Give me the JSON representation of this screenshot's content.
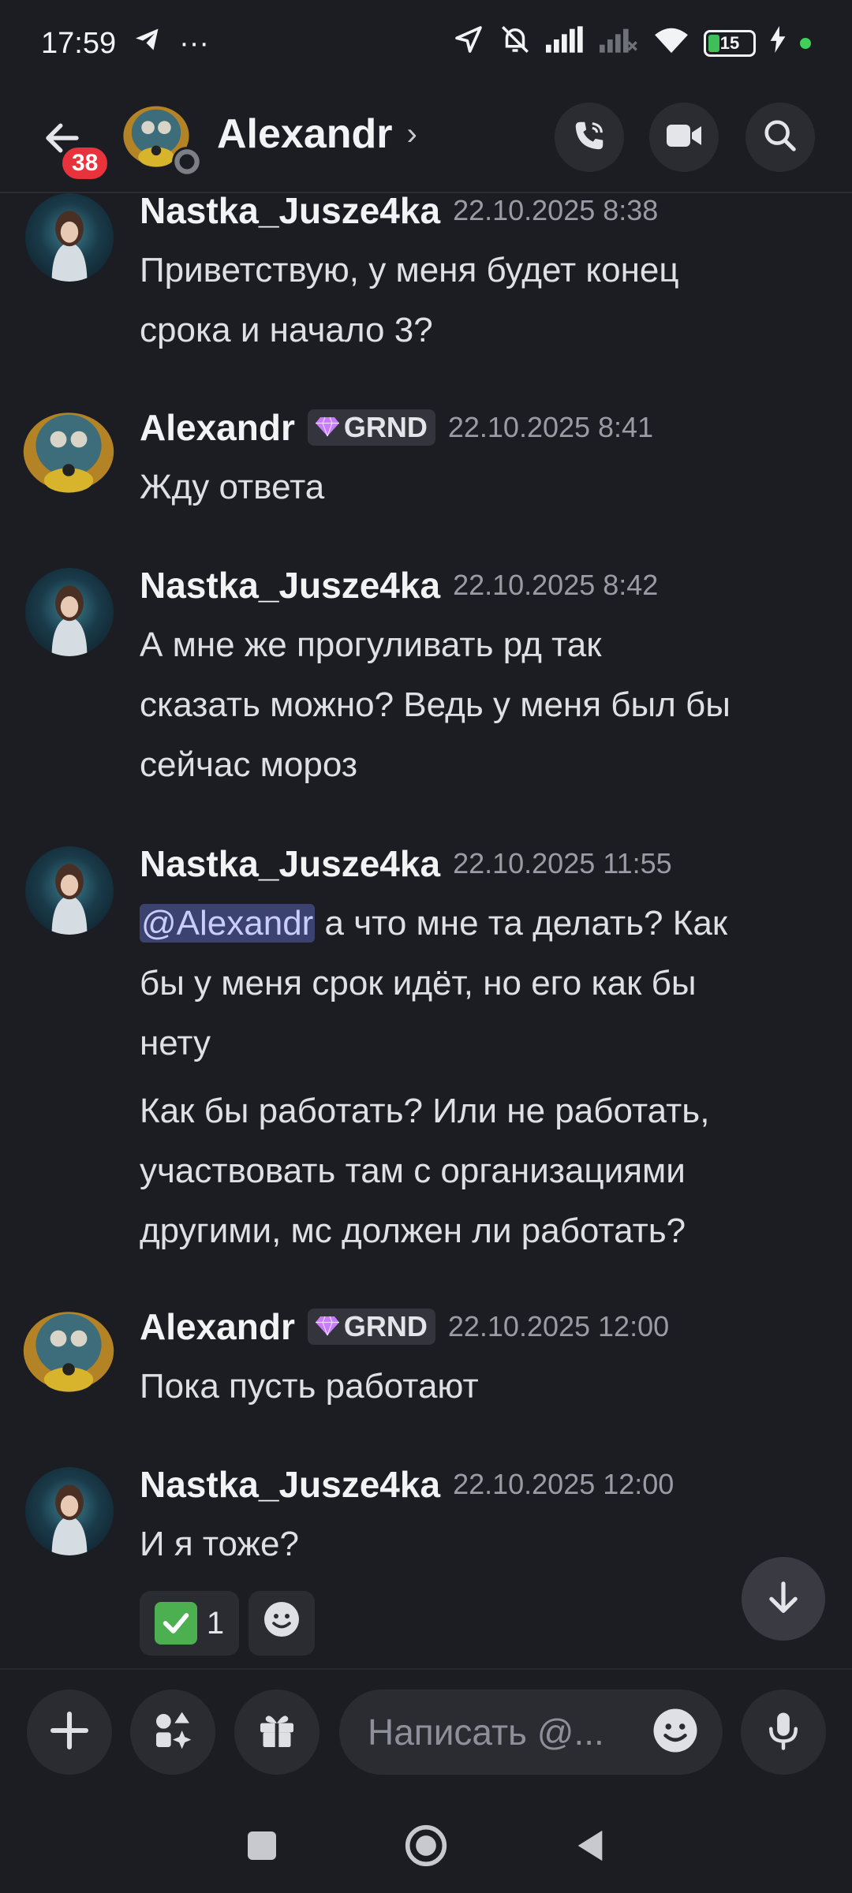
{
  "status_bar": {
    "time": "17:59",
    "dots": "···",
    "battery": "15",
    "icons": [
      "telegram-icon",
      "location-icon",
      "mute-icon",
      "signal-icon",
      "signal-2-icon",
      "wifi-icon",
      "battery-icon",
      "charging-icon"
    ]
  },
  "header": {
    "back_badge": "38",
    "title": "Alexandr",
    "chevron": "›",
    "actions": [
      "call-icon",
      "video-icon",
      "search-icon"
    ]
  },
  "messages": [
    {
      "author": "Nastka_Jusze4ka",
      "timestamp": "22.10.2025 8:38",
      "lines": [
        "Приветствую, у меня будет конец",
        "срока и начало 3?"
      ]
    },
    {
      "author": "Alexandr",
      "tag": "GRND",
      "timestamp": "22.10.2025 8:41",
      "lines": [
        "Жду ответа"
      ]
    },
    {
      "author": "Nastka_Jusze4ka",
      "timestamp": "22.10.2025 8:42",
      "lines": [
        "А мне же прогуливать рд так",
        "сказать можно? Ведь у меня был бы",
        "сейчас мороз"
      ]
    },
    {
      "author": "Nastka_Jusze4ka",
      "timestamp": "22.10.2025 11:55",
      "mention": "@Alexandr",
      "first_line_rest": " а что мне та делать? Как",
      "lines": [
        "бы у меня срок идёт, но его как бы",
        "нету"
      ],
      "followup_lines": [
        "Как бы работать? Или не работать,",
        "участвовать там с организациями",
        "другими, мс должен ли работать?"
      ]
    },
    {
      "author": "Alexandr",
      "tag": "GRND",
      "timestamp": "22.10.2025 12:00",
      "lines": [
        "Пока пусть работают"
      ]
    },
    {
      "author": "Nastka_Jusze4ka",
      "timestamp": "22.10.2025 12:00",
      "lines": [
        "И я тоже?"
      ]
    }
  ],
  "reactions": {
    "check_count": "1"
  },
  "composer": {
    "placeholder": "Написать @..."
  },
  "colors": {
    "background": "#1c1d22",
    "surface": "#2b2c32",
    "mention_bg": "#3c4270",
    "badge_red": "#e8323c"
  }
}
